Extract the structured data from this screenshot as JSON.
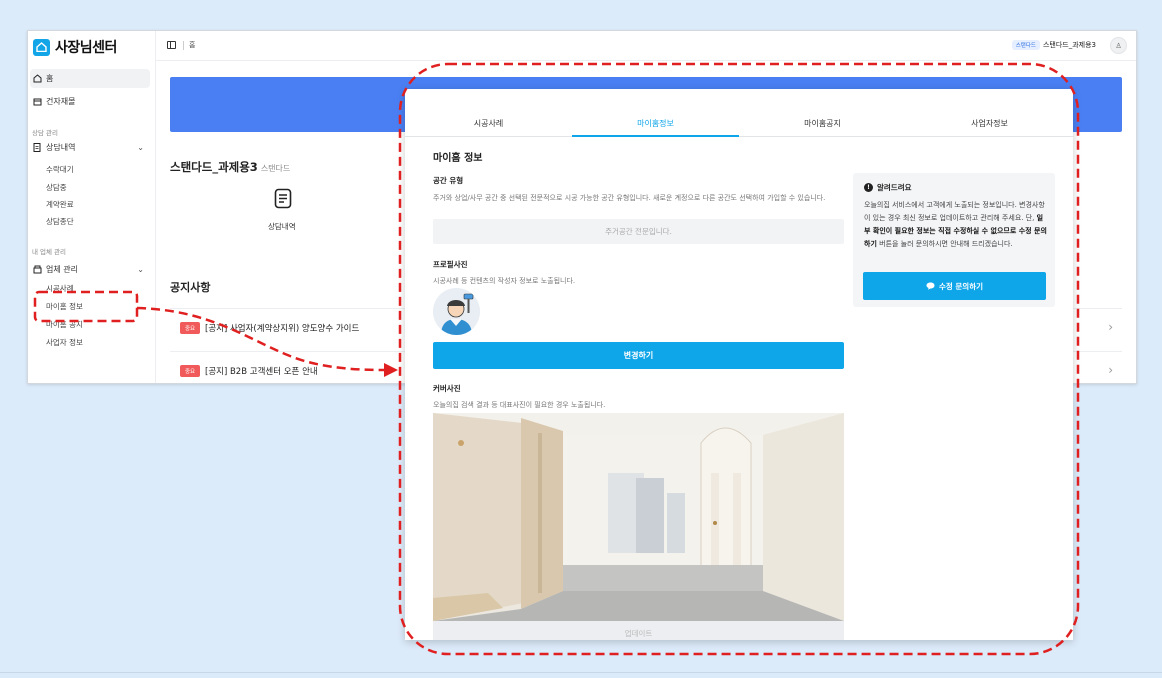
{
  "sidebar": {
    "app_name": "사장님센터",
    "home": "홈",
    "materials": "건자재몰",
    "consult_group": "상담 관리",
    "consult": "상담내역",
    "consult_subs": [
      "수락대기",
      "상담중",
      "계약완료",
      "상담종단"
    ],
    "company_group": "내 업체 관리",
    "company": "업체 관리",
    "company_subs": [
      "시공사례",
      "마이홈 정보",
      "마이홈 공지",
      "사업자 정보"
    ]
  },
  "topbar": {
    "breadcrumb": "홈",
    "badge": "스탠다드",
    "user": "스탠다드_과제용3",
    "avatar_glyph": "♙"
  },
  "dashboard": {
    "company_name": "스탠다드_과제용3",
    "company_tier": "스탠다드",
    "consult_label": "상담내역",
    "notice_title": "공지사항",
    "notices": [
      {
        "badge": "중요",
        "text": "[공지] 사업자(계약상지위) 양도양수 가이드"
      },
      {
        "badge": "중요",
        "text": "[공지] B2B 고객센터 오픈 안내"
      }
    ]
  },
  "popup": {
    "tabs": [
      {
        "label": "시공사례",
        "active": false
      },
      {
        "label": "마이홈정보",
        "active": true
      },
      {
        "label": "마이홈공지",
        "active": false
      },
      {
        "label": "사업자정보",
        "active": false
      }
    ],
    "title": "마이홈 정보",
    "space_type": {
      "heading": "공간 유형",
      "desc": "주거와 상업/사무 공간 중 선택된 전문적으로 시공 가능한 공간 유형입니다. 새로운 계정으로 다른 공간도 선택하여 가입할 수 있습니다.",
      "value": "주거공간 전문입니다."
    },
    "profile": {
      "heading": "프로필사진",
      "desc": "시공사례 등 컨텐츠의 작성자 정보로 노출됩니다.",
      "button": "변경하기"
    },
    "cover": {
      "heading": "커버사진",
      "desc": "오늘의집 검색 결과 등 대표사진이 필요한 경우 노출됩니다.",
      "button": "업데이트"
    },
    "info": {
      "title": "알려드려요",
      "line1": "오늘의집 서비스에서 고객에게 노출되는 정보입니다.",
      "line2": "변경사항이 있는 경우 최신 정보로 업데이트하고 관리해 주세요. 단,",
      "bold": "일부 확인이 필요한 정보는 직접 수정하실 수 없으므로 수정 문의하기",
      "line3": "버튼을 눌러 문의하시면 안내해 드리겠습니다.",
      "button": "수정 문의하기"
    }
  },
  "colors": {
    "accent": "#0ea5e9",
    "banner": "#4a7ff3",
    "badge_red": "#f15a5a",
    "annotation_red": "#e02020"
  }
}
